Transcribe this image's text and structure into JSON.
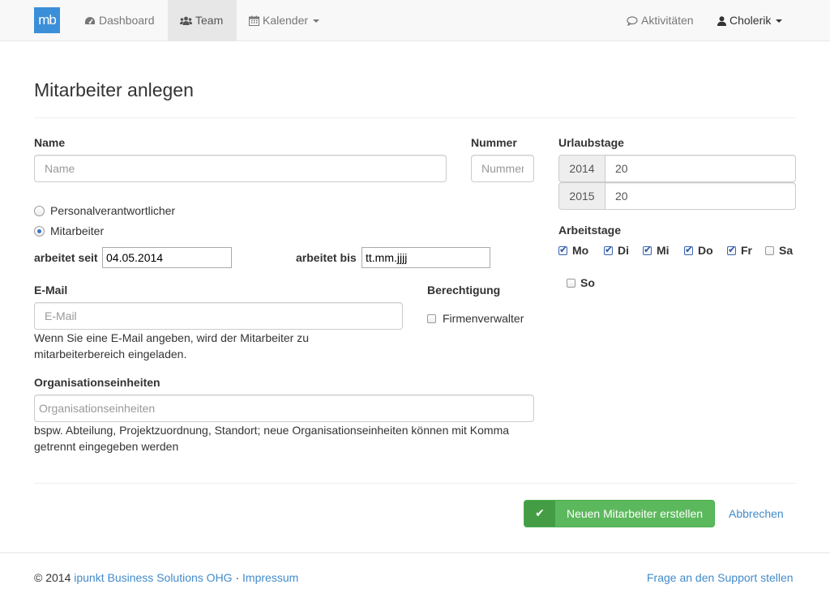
{
  "nav": {
    "brand": "mb",
    "dashboard": "Dashboard",
    "team": "Team",
    "calendar": "Kalender",
    "activities": "Aktivitäten",
    "user": "Cholerik"
  },
  "page": {
    "title": "Mitarbeiter anlegen"
  },
  "form": {
    "name_label": "Name",
    "name_placeholder": "Name",
    "number_label": "Nummer",
    "number_placeholder": "Nummer",
    "role_manager": "Personalverantwortlicher",
    "role_employee": "Mitarbeiter",
    "works_since_label": "arbeitet seit",
    "works_since_value": "04.05.2014",
    "works_until_label": "arbeitet bis",
    "works_until_value": "tt.mm.jjjj",
    "email_label": "E-Mail",
    "email_placeholder": "E-Mail",
    "email_help": "Wenn Sie eine E-Mail angeben, wird der Mitarbeiter zu mitarbeiterbereich eingeladen.",
    "permission_label": "Berechtigung",
    "permission_company_admin": "Firmenverwalter",
    "org_label": "Organisationseinheiten",
    "org_placeholder": "Organisationseinheiten",
    "org_help": "bspw. Abteilung, Projektzuordnung, Standort; neue Organisationseinheiten können mit Komma getrennt eingegeben werden",
    "vacation_label": "Urlaubstage",
    "vacation": [
      {
        "year": "2014",
        "days": "20"
      },
      {
        "year": "2015",
        "days": "20"
      }
    ],
    "workdays_label": "Arbeitstage",
    "workdays": [
      {
        "label": "Mo",
        "checked": true
      },
      {
        "label": "Di",
        "checked": true
      },
      {
        "label": "Mi",
        "checked": true
      },
      {
        "label": "Do",
        "checked": true
      },
      {
        "label": "Fr",
        "checked": true
      },
      {
        "label": "Sa",
        "checked": false
      },
      {
        "label": "So",
        "checked": false
      }
    ]
  },
  "actions": {
    "create": "Neuen Mitarbeiter erstellen",
    "cancel": "Abbrechen"
  },
  "footer": {
    "copyright": "© 2014",
    "company": "ipunkt Business Solutions OHG",
    "separator": "·",
    "imprint": "Impressum",
    "support": "Frage an den Support stellen"
  },
  "colors": {
    "primary": "#428bca",
    "success": "#5cb85c",
    "brand": "#3b8fd8"
  }
}
